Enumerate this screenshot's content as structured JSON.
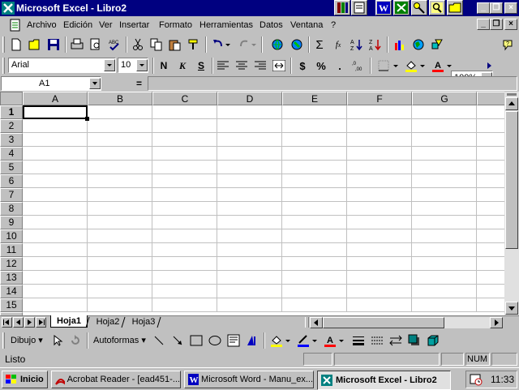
{
  "window": {
    "title": "Microsoft Excel - Libro2"
  },
  "menu": {
    "items": [
      "Archivo",
      "Edición",
      "Ver",
      "Insertar",
      "Formato",
      "Herramientas",
      "Datos",
      "Ventana",
      "?"
    ]
  },
  "toolbar": {
    "sigma": "Σ",
    "zoom": "100%"
  },
  "format": {
    "font": "Arial",
    "size": "10",
    "bold": "N",
    "italic": "K",
    "underline": "S",
    "currency": "$",
    "percent": "%",
    "thousands": "."
  },
  "formula": {
    "name_box": "A1",
    "equals": "="
  },
  "sheet": {
    "columns": [
      "A",
      "B",
      "C",
      "D",
      "E",
      "F",
      "G"
    ],
    "rows": [
      "1",
      "2",
      "3",
      "4",
      "5",
      "6",
      "7",
      "8",
      "9",
      "10",
      "11",
      "12",
      "13",
      "14",
      "15"
    ],
    "tabs": [
      "Hoja1",
      "Hoja2",
      "Hoja3"
    ],
    "active_tab": "Hoja1"
  },
  "drawing": {
    "dibujo": "Dibujo",
    "autoformas": "Autoformas"
  },
  "status": {
    "text": "Listo",
    "num": "NUM"
  },
  "taskbar": {
    "start": "Inicio",
    "tasks": [
      {
        "label": "Acrobat Reader - [ead451-..."
      },
      {
        "label": "Microsoft Word - Manu_ex..."
      },
      {
        "label": "Microsoft Excel - Libro2"
      }
    ],
    "clock": "11:33"
  },
  "colors": {
    "titlebar": "#000080",
    "face": "#c0c0c0",
    "fill_highlight": "#ffff00",
    "font_red": "#ff0000"
  }
}
